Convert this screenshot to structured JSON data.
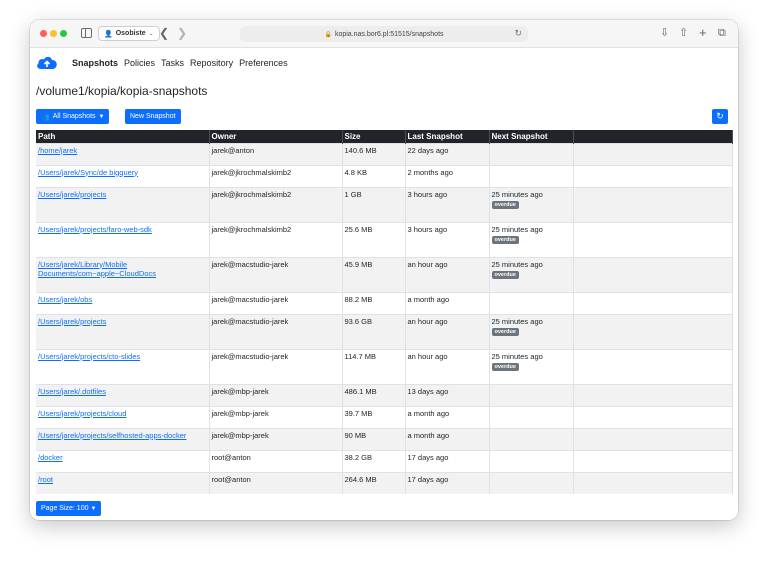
{
  "browser": {
    "profile": "Osobiste",
    "url": "kopia.nas.bor6.pl:51515/snapshots"
  },
  "nav": {
    "items": [
      {
        "label": "Snapshots",
        "active": true
      },
      {
        "label": "Policies",
        "active": false
      },
      {
        "label": "Tasks",
        "active": false
      },
      {
        "label": "Repository",
        "active": false
      },
      {
        "label": "Preferences",
        "active": false
      }
    ]
  },
  "page": {
    "title": "/volume1/kopia/kopia-snapshots",
    "all_snapshots_label": "All Snapshots",
    "new_snapshot_label": "New Snapshot",
    "page_size_label": "Page Size: 100"
  },
  "colors": {
    "primary": "#0d6efd",
    "header_bg": "#212529",
    "badge_bg": "#6c757d"
  },
  "table": {
    "columns": [
      "Path",
      "Owner",
      "Size",
      "Last Snapshot",
      "Next Snapshot",
      ""
    ],
    "rows": [
      {
        "path": "/home/jarek",
        "owner": "jarek@anton",
        "size": "140.6 MB",
        "last": "22 days ago",
        "next": "",
        "badge": ""
      },
      {
        "path": "/Users/jarek/Sync/de bigquery",
        "owner": "jarek@jkrochmalskimb2",
        "size": "4.8 KB",
        "last": "2 months ago",
        "next": "",
        "badge": ""
      },
      {
        "path": "/Users/jarek/projects",
        "owner": "jarek@jkrochmalskimb2",
        "size": "1 GB",
        "last": "3 hours ago",
        "next": "25 minutes ago",
        "badge": "overdue"
      },
      {
        "path": "/Users/jarek/projects/faro-web-sdk",
        "owner": "jarek@jkrochmalskimb2",
        "size": "25.6 MB",
        "last": "3 hours ago",
        "next": "25 minutes ago",
        "badge": "overdue"
      },
      {
        "path": "/Users/jarek/Library/Mobile Documents/com~apple~CloudDocs",
        "owner": "jarek@macstudio-jarek",
        "size": "45.9 MB",
        "last": "an hour ago",
        "next": "25 minutes ago",
        "badge": "overdue"
      },
      {
        "path": "/Users/jarek/obs",
        "owner": "jarek@macstudio-jarek",
        "size": "88.2 MB",
        "last": "a month ago",
        "next": "",
        "badge": ""
      },
      {
        "path": "/Users/jarek/projects",
        "owner": "jarek@macstudio-jarek",
        "size": "93.6 GB",
        "last": "an hour ago",
        "next": "25 minutes ago",
        "badge": "overdue"
      },
      {
        "path": "/Users/jarek/projects/cto-slides",
        "owner": "jarek@macstudio-jarek",
        "size": "114.7 MB",
        "last": "an hour ago",
        "next": "25 minutes ago",
        "badge": "overdue"
      },
      {
        "path": "/Users/jarek/.dotfiles",
        "owner": "jarek@mbp-jarek",
        "size": "486.1 MB",
        "last": "13 days ago",
        "next": "",
        "badge": ""
      },
      {
        "path": "/Users/jarek/projects/cloud",
        "owner": "jarek@mbp-jarek",
        "size": "39.7 MB",
        "last": "a month ago",
        "next": "",
        "badge": ""
      },
      {
        "path": "/Users/jarek/projects/selfhosted-apps-docker",
        "owner": "jarek@mbp-jarek",
        "size": "90 MB",
        "last": "a month ago",
        "next": "",
        "badge": ""
      },
      {
        "path": "/docker",
        "owner": "root@anton",
        "size": "38.2 GB",
        "last": "17 days ago",
        "next": "",
        "badge": ""
      },
      {
        "path": "/root",
        "owner": "root@anton",
        "size": "264.6 MB",
        "last": "17 days ago",
        "next": "",
        "badge": ""
      }
    ]
  }
}
